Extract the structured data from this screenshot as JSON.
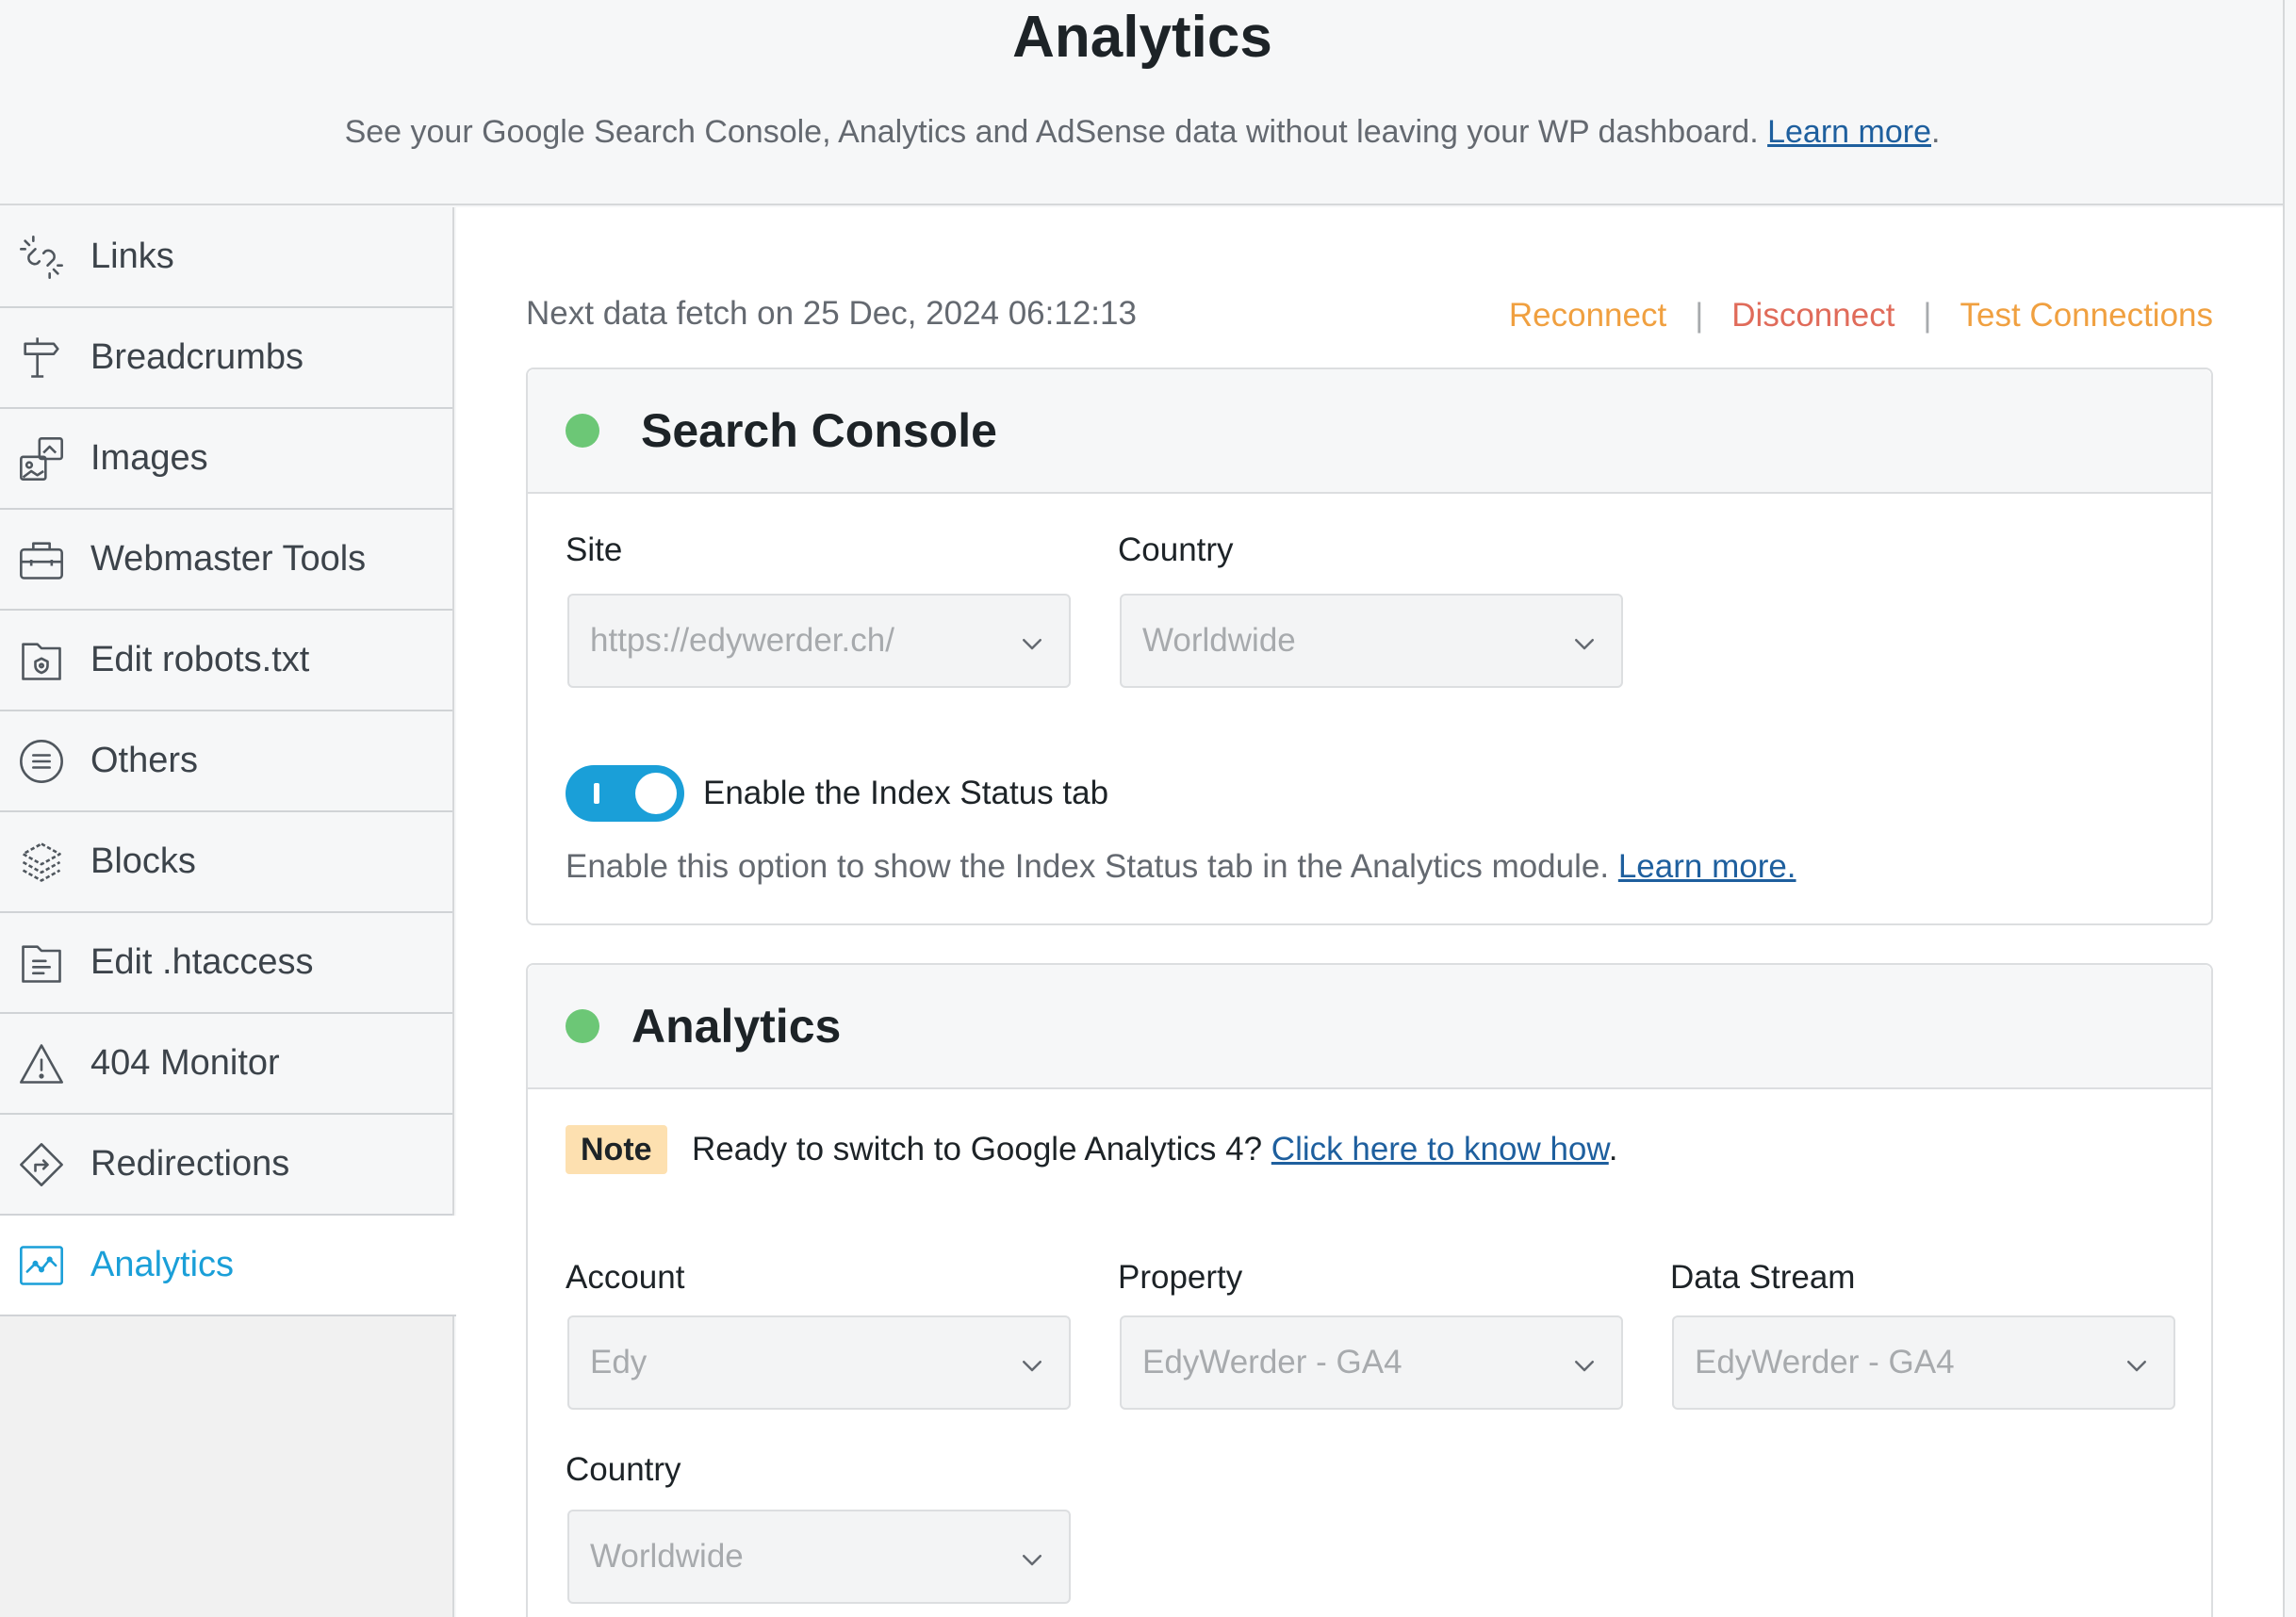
{
  "header": {
    "title": "Analytics",
    "subtitle": "See your Google Search Console, Analytics and AdSense data without leaving your WP dashboard.",
    "learn_more": "Learn more"
  },
  "sidebar": {
    "items": [
      {
        "label": "Links",
        "icon": "links-icon"
      },
      {
        "label": "Breadcrumbs",
        "icon": "signpost-icon"
      },
      {
        "label": "Images",
        "icon": "images-icon"
      },
      {
        "label": "Webmaster Tools",
        "icon": "toolbox-icon"
      },
      {
        "label": "Edit robots.txt",
        "icon": "robots-file-icon"
      },
      {
        "label": "Others",
        "icon": "list-circle-icon"
      },
      {
        "label": "Blocks",
        "icon": "blocks-icon"
      },
      {
        "label": "Edit .htaccess",
        "icon": "htaccess-file-icon"
      },
      {
        "label": "404 Monitor",
        "icon": "warning-icon"
      },
      {
        "label": "Redirections",
        "icon": "redirect-icon"
      },
      {
        "label": "Analytics",
        "icon": "analytics-icon",
        "active": true
      }
    ]
  },
  "main": {
    "fetch_text": "Next data fetch on 25 Dec, 2024 06:12:13",
    "actions": {
      "reconnect": "Reconnect",
      "separator": "|",
      "disconnect": "Disconnect",
      "test": "Test Connections"
    },
    "search_console": {
      "title": "Search Console",
      "site_label": "Site",
      "site_value": "https://edywerder.ch/",
      "country_label": "Country",
      "country_value": "Worldwide",
      "toggle_label": "Enable the Index Status tab",
      "toggle_on": true,
      "description": "Enable this option to show the Index Status tab in the Analytics module.",
      "learn_more": "Learn more."
    },
    "analytics": {
      "title": "Analytics",
      "note_badge": "Note",
      "note_text": "Ready to switch to Google Analytics 4?",
      "note_link": "Click here to know how",
      "note_period": ".",
      "account_label": "Account",
      "account_value": "Edy",
      "property_label": "Property",
      "property_value": "EdyWerder - GA4",
      "stream_label": "Data Stream",
      "stream_value": "EdyWerder - GA4",
      "country_label": "Country",
      "country_value": "Worldwide"
    }
  },
  "colors": {
    "accent": "#1a9fd8",
    "reconnect": "#f0a040",
    "disconnect": "#e06b5a",
    "status_ok": "#6cc776",
    "note_bg": "#fde0b0"
  }
}
